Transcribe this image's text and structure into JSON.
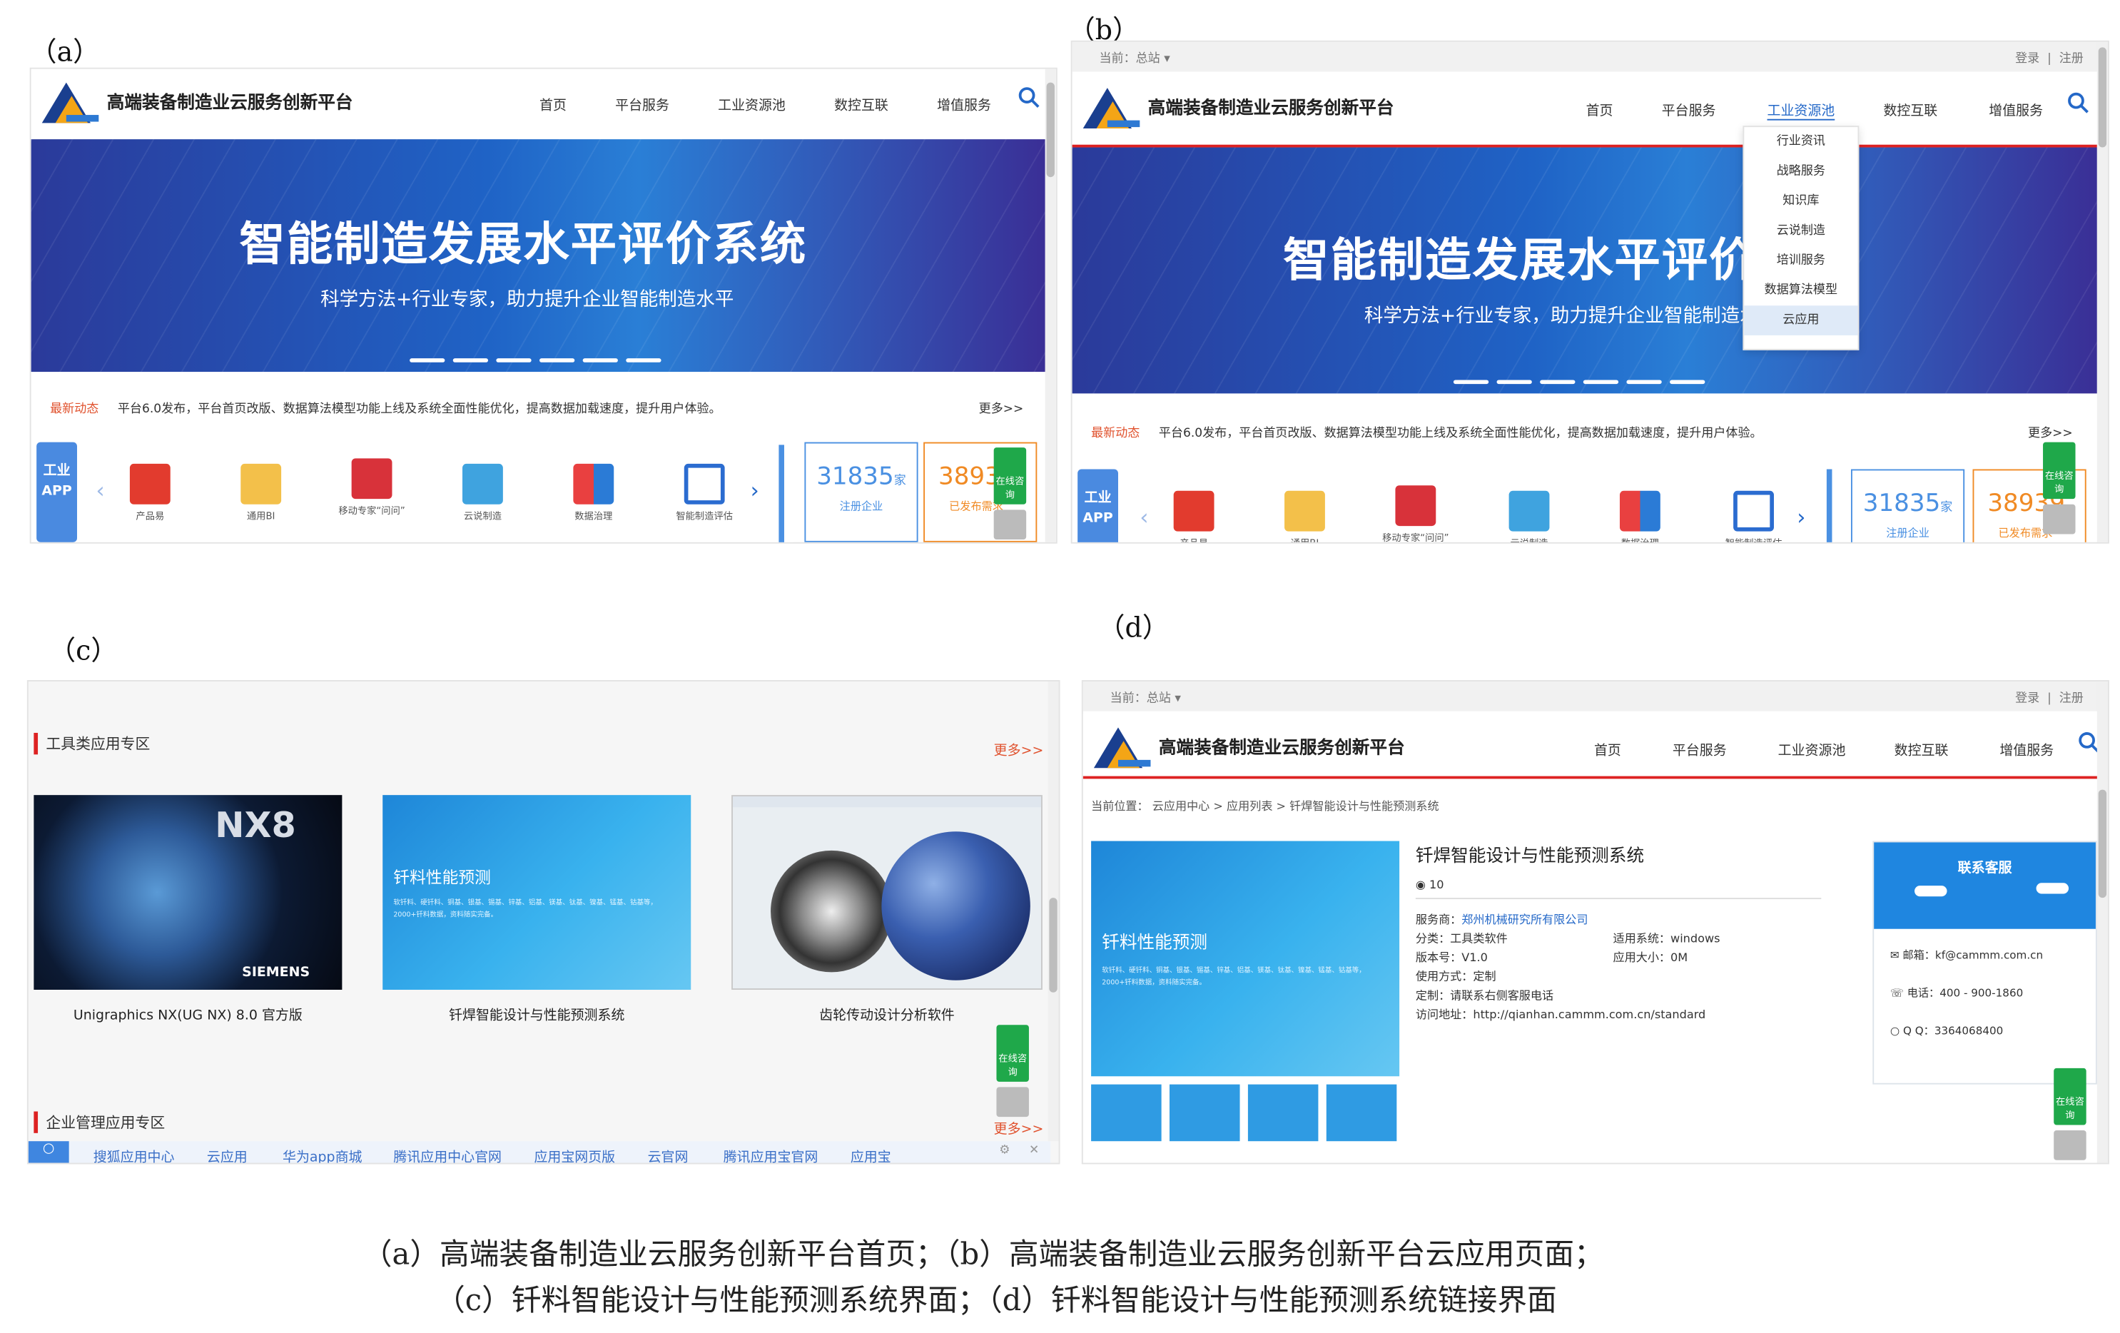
{
  "panel_labels": {
    "a": "（a）",
    "b": "（b）",
    "c": "（c）",
    "d": "（d）"
  },
  "site": {
    "title": "高端装备制造业云服务创新平台",
    "nav": [
      "首页",
      "平台服务",
      "工业资源池",
      "数控互联",
      "增值服务"
    ],
    "top_current": "当前：总站",
    "top_login": "登录",
    "top_sep": "|",
    "top_register": "注册"
  },
  "banner": {
    "title": "智能制造发展水平评价系统",
    "subtitle": "科学方法+行业专家，助力提升企业智能制造水平"
  },
  "news": {
    "tag": "最新动态",
    "text": "平台6.0发布，平台首页改版、数据算法模型功能上线及系统全面性能优化，提高数据加载速度，提升用户体验。",
    "more": "更多>>"
  },
  "app_bar": {
    "side_label": "工业APP",
    "items": [
      "产品易",
      "通用BI",
      "移动专家“问问”",
      "云说制造",
      "数据治理",
      "智能制造评估"
    ],
    "stat1_value": "31835",
    "stat1_unit": "家",
    "stat1_label": "注册企业",
    "stat2_value": "38939",
    "stat2_label": "已发布需求",
    "online_label": "在线咨询"
  },
  "dropdown": [
    "行业资讯",
    "战略服务",
    "知识库",
    "云说制造",
    "培训服务",
    "数据算法模型",
    "云应用"
  ],
  "cloud_apps": {
    "section1": "工具类应用专区",
    "section2": "企业管理应用专区",
    "more": "更多>>",
    "cards": [
      "Unigraphics NX(UG NX) 8.0 官方版",
      "钎焊智能设计与性能预测系统",
      "齿轮传动设计分析软件"
    ],
    "nx_logo": "NX8",
    "siemens": "SIEMENS",
    "card2_title": "钎料性能预测",
    "card2_sub": "软钎料、硬钎料、铜基、银基、锡基、锌基、铝基、镁基、钛基、镍基、锰基、钴基等，2000+钎料数据，资料随实完备。",
    "browser_bar": [
      "搜狐应用中心",
      "云应用",
      "华为app商城",
      "腾讯应用中心官网",
      "应用宝网页版",
      "云官网",
      "腾讯应用宝官网",
      "应用宝"
    ]
  },
  "detail": {
    "breadcrumb": "当前位置： 云应用中心 > 应用列表 > 钎焊智能设计与性能预测系统",
    "title": "钎焊智能设计与性能预测系统",
    "views": "10",
    "provider_label": "服务商：",
    "provider": "郑州机械研究所有限公司",
    "category": "分类：工具类软件",
    "system": "适用系统：windows",
    "version": "版本号：V1.0",
    "size": "应用大小：0M",
    "usage": "使用方式：定制",
    "custom": "定制：请联系右侧客服电话",
    "address": "访问地址：http://qianhan.cammm.com.cn/standard",
    "service_title": "联系客服",
    "email": "邮箱：kf@cammm.com.cn",
    "phone": "电话：400 - 900-1860",
    "qq": "Q Q：3364068400"
  },
  "captions": [
    "（a）高端装备制造业云服务创新平台首页；（b）高端装备制造业云服务创新平台云应用页面；",
    "（c）钎料智能设计与性能预测系统界面；（d）钎料智能设计与性能预测系统链接界面"
  ],
  "colors": {
    "accent": "#2468c8",
    "red": "#d22222",
    "green": "#1fa84a",
    "orange": "#f08a24"
  }
}
